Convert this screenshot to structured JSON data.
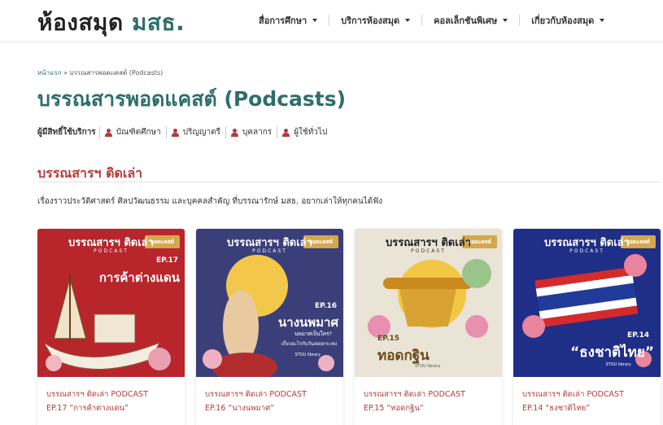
{
  "header": {
    "logo_main": "ห้องสมุด",
    "logo_accent": "มสธ.",
    "nav": [
      {
        "label": "สื่อการศึกษา"
      },
      {
        "label": "บริการห้องสมุด"
      },
      {
        "label": "คอลเล็กชันพิเศษ"
      },
      {
        "label": "เกี่ยวกับห้องสมุด"
      }
    ]
  },
  "breadcrumb": {
    "home": "หน้าแรก",
    "separator": "»",
    "current": "บรรณสารพอดแคสต์ (Podcasts)"
  },
  "page_title": "บรรณสารพอดแคสต์ (Podcasts)",
  "audience": {
    "label": "ผู้มีสิทธิ์ใช้บริการ",
    "items": [
      {
        "label": "บัณฑิตศึกษา",
        "icon": "user-icon"
      },
      {
        "label": "ปริญญาตรี",
        "icon": "user-icon"
      },
      {
        "label": "บุคลากร",
        "icon": "user-icon"
      },
      {
        "label": "ผู้ใช้ทั่วไป",
        "icon": "user-icon"
      }
    ]
  },
  "section": {
    "title": "บรรณสารฯ ติดเล่า",
    "description": "เรื่องราวประวัติศาสตร์ ศิลปวัฒนธรรม และบุคคลสำคัญ ที่บรรณารักษ์ มสธ. อยากเล่าให้ทุกคนได้ฟัง"
  },
  "cards": [
    {
      "badge": "พอดแคสต์",
      "brand": "บรรณสารฯ ติดเล่า",
      "podcast": "PODCAST",
      "episode": "EP.17",
      "cover_title": "การค้าต่างแดน",
      "line1": "บรรณสารฯ ติดเล่า PODCAST",
      "line2": "EP.17 “การค้าต่างแดน”",
      "bg": "#b8262b"
    },
    {
      "badge": "พอดแคสต์",
      "brand": "บรรณสารฯ ติดเล่า",
      "podcast": "PODCAST",
      "episode": "EP.16",
      "cover_title": "นางนพมาศ",
      "cover_sub1": "นพมาศเป็นใคร?",
      "cover_sub2": "เกี่ยวอะไรกับวันลอยกระทง",
      "cover_credit": "STOU library",
      "line1": "บรรณสารฯ ติดเล่า PODCAST",
      "line2": "EP.16 “นางนพมาศ”",
      "bg": "#3a3f7a"
    },
    {
      "badge": "พอดแคสต์",
      "brand": "บรรณสารฯ ติดเล่า",
      "podcast": "PODCAST",
      "episode": "EP.15",
      "cover_title": "ทอดกฐิน",
      "cover_credit": "STOU library",
      "line1": "บรรณสารฯ ติดเล่า PODCAST",
      "line2": "EP.15 “ทอดกฐิน”",
      "bg": "#e9e4d6"
    },
    {
      "badge": "พอดแคสต์",
      "brand": "บรรณสารฯ ติดเล่า",
      "podcast": "PODCAST",
      "episode": "EP.14",
      "cover_title": "“ธงชาติไทย”",
      "cover_credit": "STOU library",
      "line1": "บรรณสารฯ ติดเล่า PODCAST",
      "line2": "EP.14 “ธงชาติไทย”",
      "bg": "#1f2e86"
    }
  ],
  "colors": {
    "brand_green": "#2e6e6a",
    "accent_red": "#b83a3a",
    "badge_gold": "#d4a84b"
  }
}
